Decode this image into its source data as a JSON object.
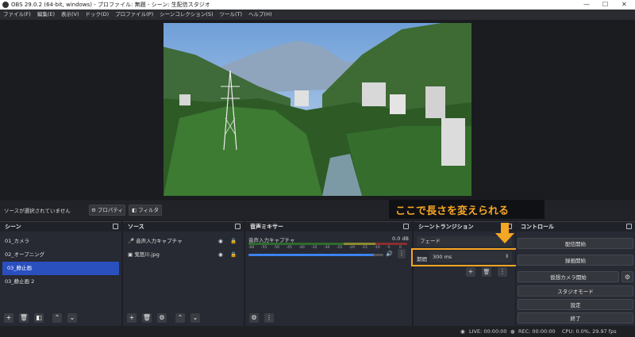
{
  "window": {
    "title": "OBS 29.0.2 (64-bit, windows) - プロファイル: 無題 - シーン: 生配信スタジオ",
    "minimize": "—",
    "maximize": "☐",
    "close": "✕"
  },
  "menu": [
    "ファイル(F)",
    "編集(E)",
    "表示(V)",
    "ドック(D)",
    "プロファイル(P)",
    "シーンコレクション(S)",
    "ツール(T)",
    "ヘルプ(H)"
  ],
  "source_toolbar": {
    "no_source": "ソースが選択されていません",
    "properties": "プロパティ",
    "filters": "フィルタ"
  },
  "annotation": {
    "text": "ここで長さを変えられる",
    "color": "#f5a623"
  },
  "scenes": {
    "title": "シーン",
    "items": [
      "01_カメラ",
      "02_オープニング",
      "03_静止画",
      "03_静止画 2"
    ],
    "selected_index": 2
  },
  "sources": {
    "title": "ソース",
    "items": [
      "音声入力キャプチャ",
      "鬼怒川.jpg"
    ]
  },
  "mixer": {
    "title": "音声ミキサー",
    "channel": "音声入力キャプチャ",
    "level": "0.0 dB",
    "scale": [
      "-60",
      "-55",
      "-50",
      "-45",
      "-40",
      "-35",
      "-30",
      "-25",
      "-20",
      "-15",
      "-10",
      "-5",
      "0"
    ],
    "volume_fraction": 0.93
  },
  "transitions": {
    "title": "シーントランジション",
    "selected": "フェード",
    "duration_label": "期間",
    "duration_value": "300 ms"
  },
  "controls": {
    "title": "コントロール",
    "start_stream": "配信開始",
    "start_record": "録画開始",
    "virtual_cam": "仮想カメラ開始",
    "studio_mode": "スタジオモード",
    "settings": "設定",
    "exit": "終了"
  },
  "status": {
    "live": "LIVE: 00:00:00",
    "rec": "REC: 00:00:00",
    "cpu": "CPU: 0.0%, 29.97 fps"
  },
  "colors": {
    "accent": "#2a4fbf",
    "highlight": "#f5a623",
    "volume_bar": "#3a82f0"
  }
}
